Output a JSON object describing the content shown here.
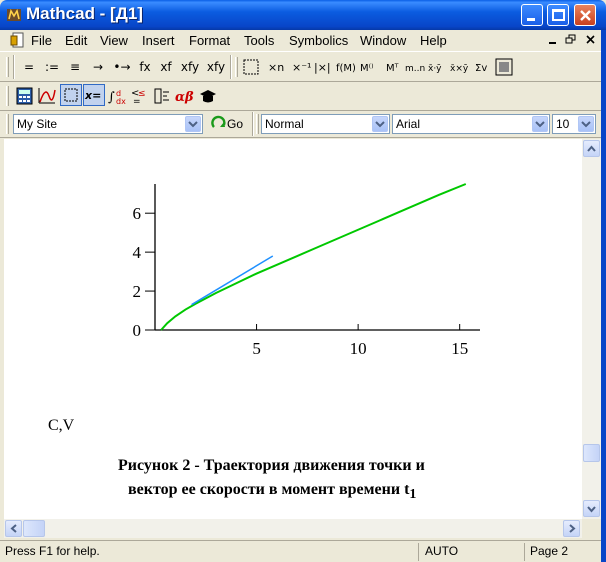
{
  "window": {
    "title": "Mathcad - [Д1]"
  },
  "menu": {
    "items": [
      "File",
      "Edit",
      "View",
      "Insert",
      "Format",
      "Tools",
      "Symbolics",
      "Window",
      "Help"
    ]
  },
  "math_toolbar": {
    "items": [
      "=",
      ":=",
      "≡",
      "→",
      "•→",
      "fx",
      "xf",
      "xfy",
      "xfy"
    ]
  },
  "resource_toolbar": {
    "site_combo_value": "My Site",
    "go_label": "Go"
  },
  "format_toolbar": {
    "style_value": "Normal",
    "font_value": "Arial",
    "size_value": "10"
  },
  "document": {
    "label": "C,V",
    "caption_line1": "Рисунок 2 - Траектория движения точки и",
    "caption_line2": "вектор ее скорости в момент времени t",
    "caption_sub": "1"
  },
  "status": {
    "help": "Press F1 for help.",
    "mode": "AUTO",
    "page": "Page 2"
  },
  "chart_data": {
    "type": "line",
    "xlim": [
      0,
      16
    ],
    "ylim": [
      0,
      7.5
    ],
    "x_ticks": [
      5,
      10,
      15
    ],
    "y_ticks": [
      0,
      2,
      4,
      6
    ],
    "x_tick_labels": [
      "5",
      "10",
      "15"
    ],
    "y_tick_labels": [
      "0",
      "2",
      "4",
      "6"
    ],
    "grid": false,
    "series": [
      {
        "color": "#00c800",
        "x": [
          0.3,
          0.6,
          1.0,
          1.5,
          2.0,
          3.0,
          4.0,
          5.0,
          6.0,
          7.0,
          8.0,
          9.0,
          10.0,
          11.0,
          12.0,
          13.0,
          14.0,
          15.3
        ],
        "y": [
          0.0,
          0.35,
          0.7,
          1.05,
          1.35,
          1.9,
          2.4,
          2.9,
          3.35,
          3.8,
          4.25,
          4.7,
          5.15,
          5.6,
          6.05,
          6.5,
          6.95,
          7.5
        ]
      },
      {
        "color": "#1e90ff",
        "x": [
          1.8,
          5.8
        ],
        "y": [
          1.3,
          3.8
        ]
      }
    ]
  }
}
